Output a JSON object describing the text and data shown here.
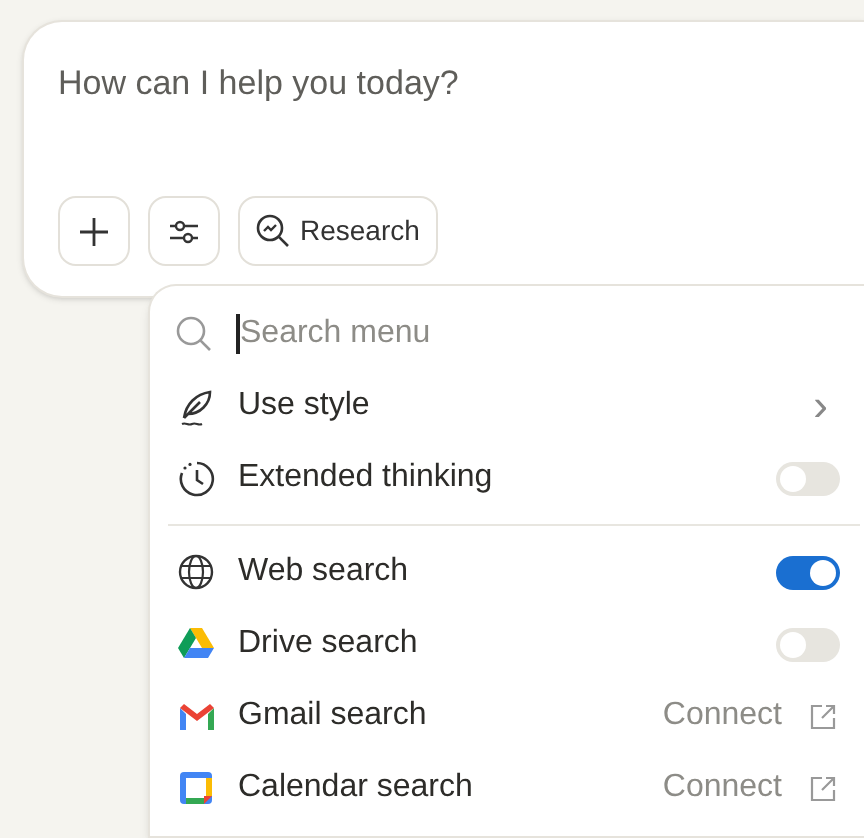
{
  "composer": {
    "placeholder": "How can I help you today?",
    "research_button": "Research"
  },
  "menu": {
    "search": {
      "placeholder": "Search menu"
    },
    "sections": [
      {
        "items": [
          {
            "kind": "submenu",
            "label": "Use style",
            "chevron": "›"
          },
          {
            "kind": "toggle",
            "label": "Extended thinking",
            "on": false
          }
        ]
      },
      {
        "items": [
          {
            "kind": "toggle",
            "label": "Web search",
            "on": true
          },
          {
            "kind": "toggle",
            "label": "Drive search",
            "on": false
          },
          {
            "kind": "connect",
            "label": "Gmail search",
            "action": "Connect"
          },
          {
            "kind": "connect",
            "label": "Calendar search",
            "action": "Connect"
          }
        ]
      }
    ]
  }
}
